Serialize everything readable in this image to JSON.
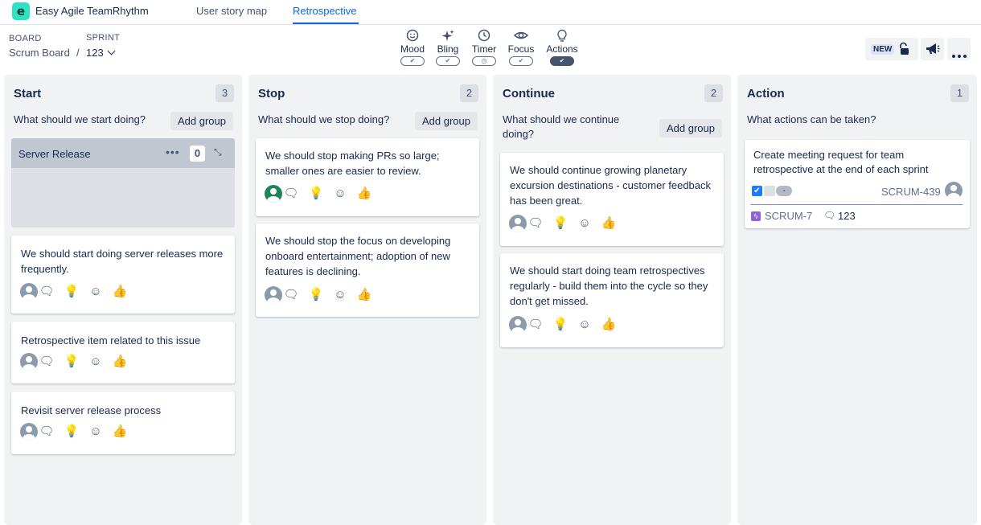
{
  "app": {
    "logo_letter": "e",
    "title": "Easy Agile TeamRhythm"
  },
  "tabs": [
    {
      "label": "User story map"
    },
    {
      "label": "Retrospective"
    }
  ],
  "board": {
    "label": "BOARD",
    "value": "Scrum Board",
    "separator": "/"
  },
  "sprint": {
    "label": "SPRINT",
    "value": "123"
  },
  "tools": [
    {
      "name": "Mood",
      "icon": "smiley-icon",
      "state": "on"
    },
    {
      "name": "Bling",
      "icon": "sparkle-icon",
      "state": "on"
    },
    {
      "name": "Timer",
      "icon": "clock-icon",
      "state": "timer"
    },
    {
      "name": "Focus",
      "icon": "eye-icon",
      "state": "on"
    },
    {
      "name": "Actions",
      "icon": "lightbulb-icon",
      "state": "active"
    }
  ],
  "right": {
    "new_label": "NEW"
  },
  "columns": [
    {
      "title": "Start",
      "count": "3",
      "question": "What should we start doing?",
      "add_group": "Add group",
      "group": {
        "name": "Server Release",
        "count": "0"
      },
      "cards": [
        {
          "text": "We should start doing server releases more frequently."
        },
        {
          "text": "Retrospective item related to this issue"
        },
        {
          "text": "Revisit server release process"
        }
      ]
    },
    {
      "title": "Stop",
      "count": "2",
      "question": "What should we stop doing?",
      "add_group": "Add group",
      "cards": [
        {
          "text": "We should stop making PRs so large; smaller ones are easier to review."
        },
        {
          "text": "We should stop the focus on developing onboard entertainment; adoption of new features is declining."
        }
      ]
    },
    {
      "title": "Continue",
      "count": "2",
      "question": "What should we continue doing?",
      "add_group": "Add group",
      "cards": [
        {
          "text": "We should continue growing planetary excursion destinations - customer feedback has been great."
        },
        {
          "text": "We should start doing team retrospectives regularly - build them into the cycle so they don't get missed."
        }
      ]
    },
    {
      "title": "Action",
      "count": "1",
      "question": "What actions can be taken?",
      "action_card": {
        "title": "Create meeting request for team retrospective at the end of each sprint",
        "status_pill": "-",
        "issue_key": "SCRUM-439",
        "linked_key": "SCRUM-7",
        "comment_count": "123"
      }
    }
  ],
  "card_actions": [
    "comment-icon",
    "lightbulb-icon",
    "emoji-add-icon",
    "thumbs-up-icon"
  ]
}
